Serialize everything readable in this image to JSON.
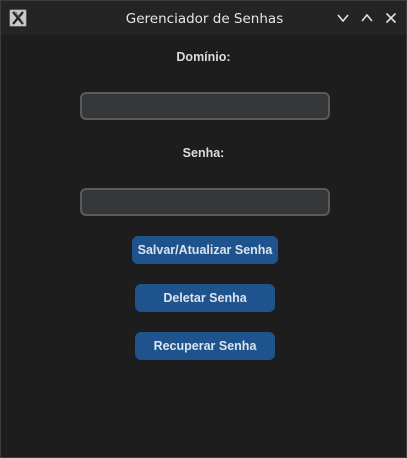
{
  "window": {
    "title": "Gerenciador de Senhas"
  },
  "titlebar_icons": {
    "app": "x-logo-icon",
    "minimize": "chevron-down-icon",
    "maximize": "chevron-up-icon",
    "close": "close-icon"
  },
  "form": {
    "domain_label": "Domínio:",
    "domain_value": "",
    "password_label": "Senha:",
    "password_value": ""
  },
  "buttons": {
    "save_label": "Salvar/Atualizar Senha",
    "delete_label": "Deletar Senha",
    "recover_label": "Recuperar Senha"
  },
  "colors": {
    "background": "#1d1d1d",
    "button": "#1f538d",
    "entry_bg": "#343638",
    "entry_border": "#565b5e"
  }
}
